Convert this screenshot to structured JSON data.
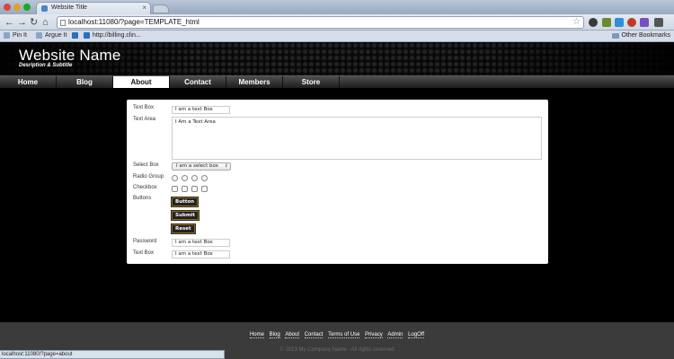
{
  "browser": {
    "tab_title": "Website Title",
    "url": "localhost:11080/?page=TEMPLATE_html",
    "bookmarks": [
      "Pin It",
      "Argue It",
      "http://billing.clin..."
    ],
    "other_bookmarks": "Other Bookmarks",
    "status_url": "localhost:11080/?page=about"
  },
  "site": {
    "name": "Website Name",
    "subtitle": "Desription & Subtitle"
  },
  "menu": {
    "items": [
      "Home",
      "Blog",
      "About",
      "Contact",
      "Members",
      "Store"
    ],
    "active": "About"
  },
  "form": {
    "labels": {
      "text_box": "Text Box",
      "text_area": "Text Area",
      "select_box": "Select Box",
      "radio_group": "Radio Group",
      "checkbox": "Checkbox",
      "buttons": "Buttons",
      "password": "Password",
      "text_box_2": "Text Box"
    },
    "values": {
      "text_box": "I am a text Box",
      "text_area": "I Am a Text Area",
      "select_box": "I am a select box",
      "password": "I am a text Box",
      "text_box_2": "I am a text Box"
    },
    "buttons": [
      "Button",
      "Submit",
      "Reset"
    ]
  },
  "footer": {
    "links": [
      "Home",
      "Blog",
      "About",
      "Contact",
      "Terms of Use",
      "Privacy",
      "Admin",
      "LogOff"
    ],
    "copyright": "© 2013 My Company Name - All rights reserved"
  }
}
